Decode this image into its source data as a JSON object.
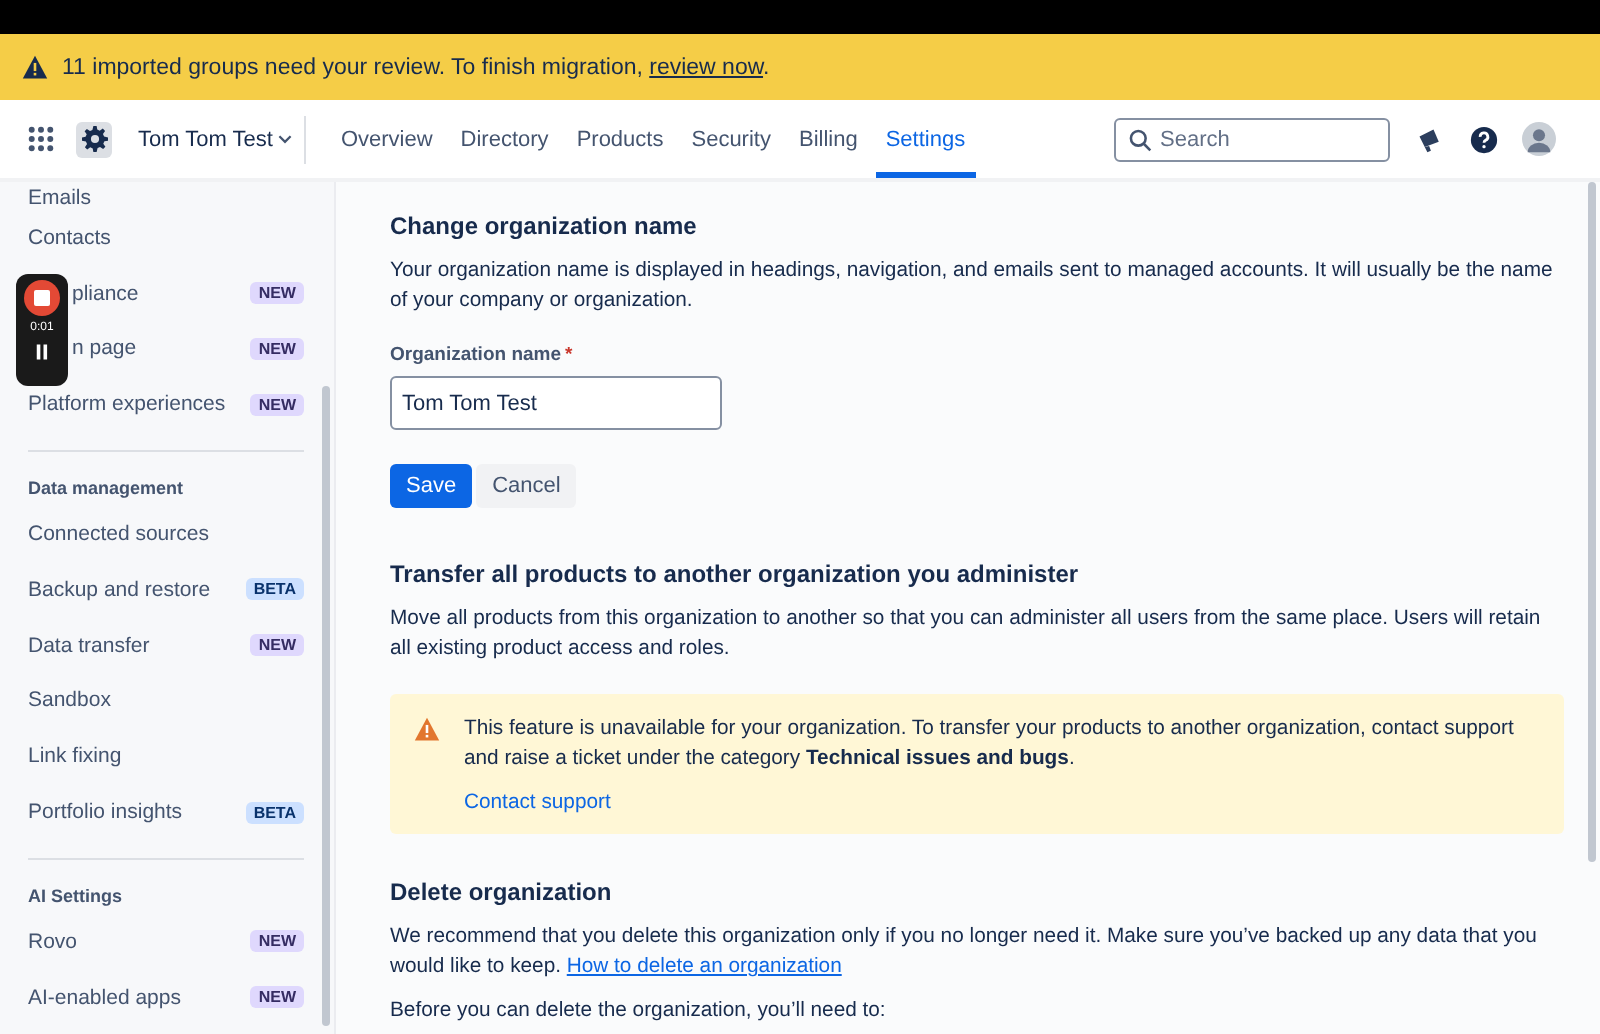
{
  "banner": {
    "text": "11 imported groups need your review. To finish migration, ",
    "link": "review now",
    "end": "."
  },
  "nav": {
    "org": "Tom Tom Test",
    "tabs": [
      {
        "label": "Overview",
        "selected": false
      },
      {
        "label": "Directory",
        "selected": false
      },
      {
        "label": "Products",
        "selected": false
      },
      {
        "label": "Security",
        "selected": false
      },
      {
        "label": "Billing",
        "selected": false
      },
      {
        "label": "Settings",
        "selected": true
      }
    ],
    "search": {
      "placeholder": "Search"
    }
  },
  "recorder": {
    "time": "0:01"
  },
  "sidebar": {
    "items": [
      {
        "kind": "item",
        "label": "Emails",
        "cut_top": true
      },
      {
        "kind": "item",
        "label": "Contacts"
      },
      {
        "kind": "item",
        "label": "pliance",
        "covered": true,
        "badge": {
          "text": "NEW",
          "kind": "new"
        }
      },
      {
        "kind": "item",
        "label": "n page",
        "covered": true,
        "badge": {
          "text": "NEW",
          "kind": "new"
        }
      },
      {
        "kind": "item",
        "label": "Platform experiences",
        "badge": {
          "text": "NEW",
          "kind": "new"
        }
      },
      {
        "kind": "divider"
      },
      {
        "kind": "header",
        "label": "Data management"
      },
      {
        "kind": "item",
        "label": "Connected sources"
      },
      {
        "kind": "item",
        "label": "Backup and restore",
        "badge": {
          "text": "BETA",
          "kind": "beta"
        }
      },
      {
        "kind": "item",
        "label": "Data transfer",
        "badge": {
          "text": "NEW",
          "kind": "new"
        }
      },
      {
        "kind": "item",
        "label": "Sandbox"
      },
      {
        "kind": "item",
        "label": "Link fixing"
      },
      {
        "kind": "item",
        "label": "Portfolio insights",
        "badge": {
          "text": "BETA",
          "kind": "beta"
        }
      },
      {
        "kind": "divider"
      },
      {
        "kind": "header",
        "label": "AI Settings"
      },
      {
        "kind": "item",
        "label": "Rovo",
        "badge": {
          "text": "NEW",
          "kind": "new"
        }
      },
      {
        "kind": "item",
        "label": "AI-enabled apps",
        "badge": {
          "text": "NEW",
          "kind": "new"
        }
      }
    ]
  },
  "rename": {
    "title": "Change organization name",
    "text": "Your organization name is displayed in headings, navigation, and emails sent to managed accounts. It will usually be the name of your company or organization.",
    "field_label": "Organization name",
    "required_mark": "*",
    "value": "Tom Tom Test",
    "buttons": [
      "Save",
      "Cancel"
    ]
  },
  "transfer": {
    "title": "Transfer all products to another organization you administer",
    "text": "Move all products from this organization to another so that you can administer all users from the same place. Users will retain all existing product access and roles.",
    "warning": "This feature is unavailable for your organization. To transfer your products to another organization, contact support and raise a ticket under the category **Technical issues and bugs**.",
    "link": "Contact support"
  },
  "delete": {
    "title": "Delete organization",
    "text": "We recommend that you delete this organization only if you no longer need it. Make sure you’ve backed up any data that you would like to keep. ",
    "link": "How to delete an organization",
    "before": "Before you can delete the organization, you’ll need to:"
  }
}
